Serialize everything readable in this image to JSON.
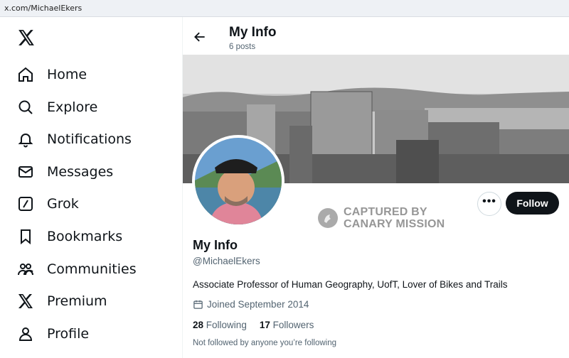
{
  "browser": {
    "url": "x.com/MichaelEkers"
  },
  "sidebar": {
    "logo_icon": "x-logo-icon",
    "items": [
      {
        "label": "Home",
        "icon": "home-icon"
      },
      {
        "label": "Explore",
        "icon": "search-icon"
      },
      {
        "label": "Notifications",
        "icon": "bell-icon"
      },
      {
        "label": "Messages",
        "icon": "envelope-icon"
      },
      {
        "label": "Grok",
        "icon": "grok-icon"
      },
      {
        "label": "Bookmarks",
        "icon": "bookmark-icon"
      },
      {
        "label": "Communities",
        "icon": "people-icon"
      },
      {
        "label": "Premium",
        "icon": "x-logo-icon"
      },
      {
        "label": "Profile",
        "icon": "person-icon"
      }
    ]
  },
  "header": {
    "title": "My Info",
    "subtitle": "6 posts"
  },
  "profile": {
    "name": "My Info",
    "handle": "@MichaelEkers",
    "bio": "Associate Professor of Human Geography, UofT, Lover of Bikes and Trails",
    "joined": "Joined September 2014",
    "following_count": "28",
    "following_label": "Following",
    "followers_count": "17",
    "followers_label": "Followers",
    "not_followed_text": "Not followed by anyone you’re following",
    "follow_button": "Follow",
    "more_button": "•••"
  },
  "watermark": {
    "line1": "CAPTURED BY",
    "line2": "CANARY MISSION"
  },
  "colors": {
    "follow_bg": "#0f1419",
    "secondary_text": "#536471",
    "border": "#cfd9de"
  }
}
